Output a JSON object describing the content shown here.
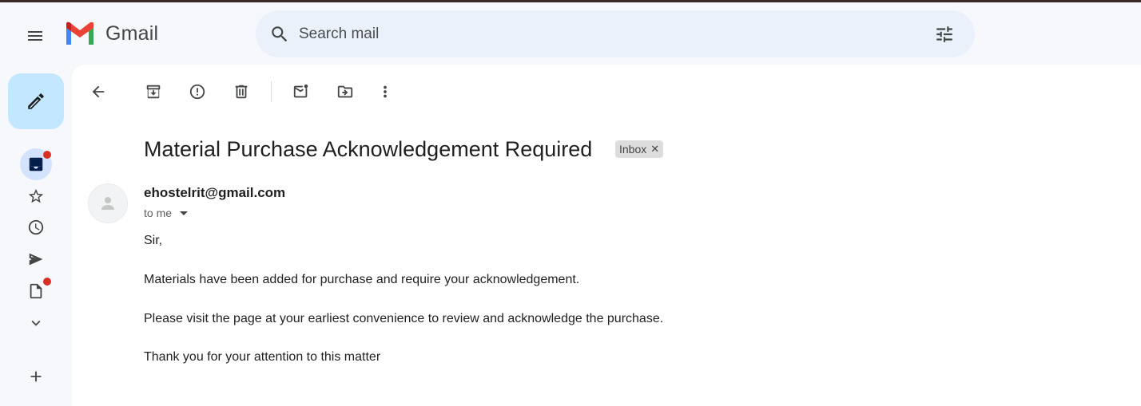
{
  "app": {
    "name": "Gmail",
    "brand_colors": {
      "red": "#EA4335",
      "blue": "#4285F4",
      "green": "#34A853",
      "yellow": "#FBBC04"
    }
  },
  "search": {
    "placeholder": "Search mail",
    "value": ""
  },
  "rail": {
    "items": [
      {
        "icon": "inbox-icon",
        "active": true,
        "unread_dot": true
      },
      {
        "icon": "star-icon",
        "active": false,
        "unread_dot": false
      },
      {
        "icon": "clock-icon",
        "active": false,
        "unread_dot": false
      },
      {
        "icon": "send-icon",
        "active": false,
        "unread_dot": false
      },
      {
        "icon": "draft-icon",
        "active": false,
        "unread_dot": true
      },
      {
        "icon": "chevron-down-icon",
        "active": false,
        "unread_dot": false
      },
      {
        "icon": "plus-icon",
        "active": false,
        "unread_dot": false
      }
    ]
  },
  "toolbar": {
    "icons": [
      "back-arrow-icon",
      "archive-icon",
      "report-spam-icon",
      "delete-icon",
      "mark-unread-icon",
      "move-to-icon",
      "more-vert-icon"
    ]
  },
  "email": {
    "subject": "Material Purchase Acknowledgement Required",
    "label": "Inbox",
    "sender": "ehostelrit@gmail.com",
    "recipient_text": "to me",
    "body": [
      "Sir,",
      "Materials have been added for purchase and require your acknowledgement.",
      "Please visit the page at your earliest convenience to review and acknowledge the purchase.",
      "Thank you for your attention to this matter"
    ]
  }
}
